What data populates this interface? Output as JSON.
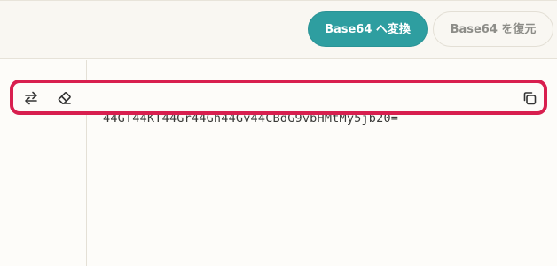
{
  "actions": {
    "encode_label": "Base64 へ変換",
    "decode_label": "Base64 を復元"
  },
  "toolbar": {
    "swap_icon": "swap-arrows-icon",
    "clear_icon": "eraser-icon",
    "copy_icon": "copy-icon"
  },
  "output": {
    "value": "44GT44KT44Gr44Gh44Gv44CBdG9vbHMtMy5jb20="
  },
  "colors": {
    "accent": "#2e9ea0",
    "highlight": "#d81f4f",
    "background": "#fdfcf9"
  }
}
